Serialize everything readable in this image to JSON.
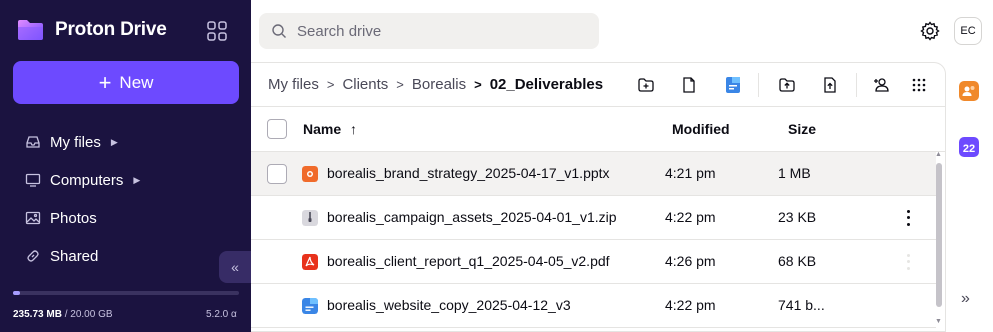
{
  "app": {
    "name": "Proton Drive"
  },
  "sidebar": {
    "new_label": "New",
    "items": [
      {
        "label": "My files",
        "icon": "inbox-icon",
        "has_caret": true
      },
      {
        "label": "Computers",
        "icon": "monitor-icon",
        "has_caret": true
      },
      {
        "label": "Photos",
        "icon": "image-icon",
        "has_caret": false
      },
      {
        "label": "Shared",
        "icon": "link-icon",
        "has_caret": false
      }
    ],
    "storage_used": "235.73 MB",
    "storage_total": "/ 20.00 GB",
    "storage_fraction": 0.012,
    "version": "5.2.0 α"
  },
  "search": {
    "placeholder": "Search drive"
  },
  "user": {
    "initials": "EC"
  },
  "breadcrumb": {
    "items": [
      "My files",
      "Clients",
      "Borealis"
    ],
    "current": "02_Deliverables"
  },
  "table": {
    "headers": {
      "name": "Name",
      "modified": "Modified",
      "size": "Size"
    },
    "sort_indicator": "↑",
    "rows": [
      {
        "name": "borealis_brand_strategy_2025-04-17_v1.pptx",
        "modified": "4:21 pm",
        "size": "1 MB",
        "type": "pptx"
      },
      {
        "name": "borealis_campaign_assets_2025-04-01_v1.zip",
        "modified": "4:22 pm",
        "size": "23 KB",
        "type": "zip"
      },
      {
        "name": "borealis_client_report_q1_2025-04-05_v2.pdf",
        "modified": "4:26 pm",
        "size": "68 KB",
        "type": "pdf"
      },
      {
        "name": "borealis_website_copy_2025-04-12_v3",
        "modified": "4:22 pm",
        "size": "741 b...",
        "type": "doc"
      }
    ]
  },
  "rail": {
    "calendar_day": "22"
  },
  "colors": {
    "sidebar_bg": "#1b1340",
    "accent": "#6d4aff",
    "pptx": "#f06b2b",
    "pdf": "#e8321c",
    "doc": "#3a86e6"
  }
}
